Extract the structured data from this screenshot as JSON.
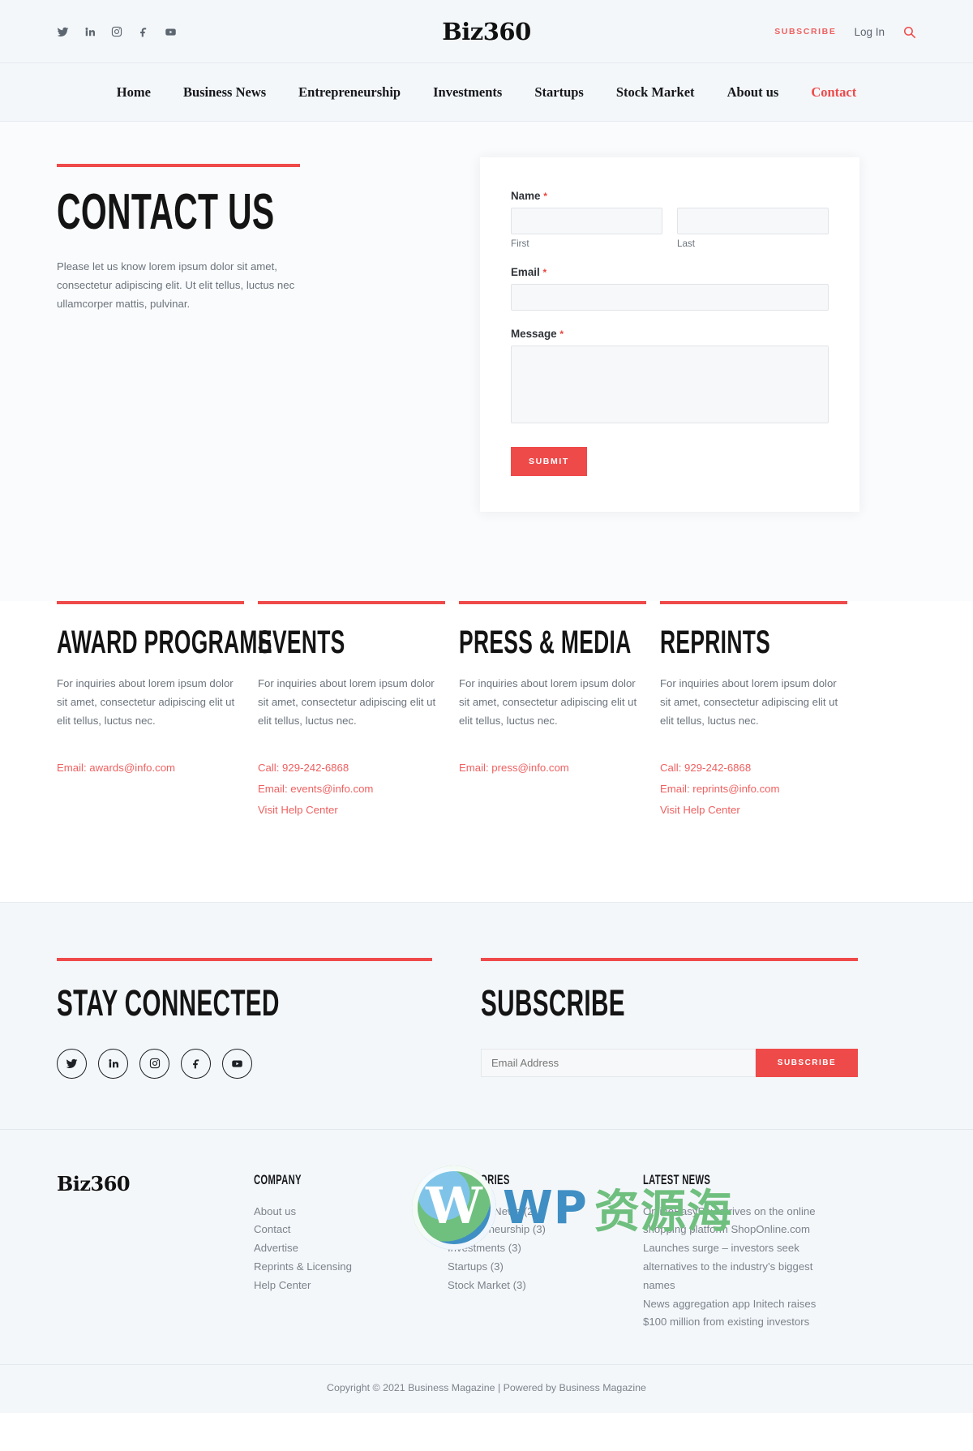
{
  "brand": {
    "name": "Biz360"
  },
  "topbar": {
    "social": [
      {
        "name": "twitter-icon",
        "label": "Twitter"
      },
      {
        "name": "linkedin-icon",
        "label": "LinkedIn"
      },
      {
        "name": "instagram-icon",
        "label": "Instagram"
      },
      {
        "name": "facebook-icon",
        "label": "Facebook"
      },
      {
        "name": "youtube-icon",
        "label": "YouTube"
      }
    ],
    "subscribe_label": "SUBSCRIBE",
    "login_label": "Log In",
    "search_icon": "search-icon"
  },
  "nav": {
    "items": [
      {
        "label": "Home",
        "active": false
      },
      {
        "label": "Business News",
        "active": false
      },
      {
        "label": "Entrepreneurship",
        "active": false
      },
      {
        "label": "Investments",
        "active": false
      },
      {
        "label": "Startups",
        "active": false
      },
      {
        "label": "Stock Market",
        "active": false
      },
      {
        "label": "About us",
        "active": false
      },
      {
        "label": "Contact",
        "active": true
      }
    ]
  },
  "hero": {
    "title": "CONTACT US",
    "description": "Please let us know lorem ipsum dolor sit amet, consectetur adipiscing elit. Ut elit tellus, luctus nec ullamcorper mattis, pulvinar."
  },
  "form": {
    "name_label": "Name",
    "name_required": "*",
    "first_sublabel": "First",
    "last_sublabel": "Last",
    "first_value": "",
    "last_value": "",
    "email_label": "Email",
    "email_required": "*",
    "email_value": "",
    "message_label": "Message",
    "message_required": "*",
    "message_value": "",
    "submit_label": "SUBMIT"
  },
  "info_columns": [
    {
      "title": "AWARD PROGRAMS",
      "body": "For inquiries about lorem ipsum dolor sit amet, consectetur adipiscing elit ut elit tellus, luctus nec.",
      "links": [
        "Email: awards@info.com"
      ]
    },
    {
      "title": "EVENTS",
      "body": "For inquiries about lorem ipsum dolor sit amet, consectetur adipiscing elit ut elit tellus, luctus nec.",
      "links": [
        "Call: 929-242-6868",
        "Email: events@info.com",
        "Visit Help Center"
      ]
    },
    {
      "title": "PRESS & MEDIA",
      "body": "For inquiries about lorem ipsum dolor sit amet, consectetur adipiscing elit ut elit tellus, luctus nec.",
      "links": [
        "Email: press@info.com"
      ]
    },
    {
      "title": "REPRINTS",
      "body": "For inquiries about lorem ipsum dolor sit amet, consectetur adipiscing elit ut elit tellus, luctus nec.",
      "links": [
        "Call: 929-242-6868",
        "Email: reprints@info.com",
        "Visit Help Center"
      ]
    }
  ],
  "connect": {
    "title": "STAY CONNECTED",
    "social": [
      {
        "name": "twitter-icon",
        "label": "Twitter"
      },
      {
        "name": "linkedin-icon",
        "label": "LinkedIn"
      },
      {
        "name": "instagram-icon",
        "label": "Instagram"
      },
      {
        "name": "facebook-icon",
        "label": "Facebook"
      },
      {
        "name": "youtube-icon",
        "label": "YouTube"
      }
    ]
  },
  "subscribe": {
    "title": "SUBSCRIBE",
    "placeholder": "Email Address",
    "value": "",
    "button_label": "SUBSCRIBE"
  },
  "footer": {
    "company": {
      "heading": "COMPANY",
      "links": [
        "About us",
        "Contact",
        "Advertise",
        "Reprints & Licensing",
        "Help Center"
      ]
    },
    "categories": {
      "heading": "CATEGORIES",
      "links": [
        "Business News (2)",
        "Entrepreneurship (3)",
        "Investments (3)",
        "Startups (3)",
        "Stock Market (3)"
      ]
    },
    "latest_news": {
      "heading": "LATEST NEWS",
      "items": [
        "OnlineEasyPay arrives on the online shopping platform ShopOnline.com",
        "Launches surge – investors seek alternatives to the industry’s biggest names",
        "News aggregation app Initech raises $100 million from existing investors"
      ]
    },
    "copyright": "Copyright © 2021 Business Magazine | Powered by Business Magazine"
  },
  "watermark": {
    "wp": "WP",
    "cn": "资源海"
  },
  "colors": {
    "accent": "#ef4a4a",
    "link": "#ef6060",
    "bg": "#f4f7fa",
    "text": "#16181c",
    "muted": "#7b838c"
  }
}
